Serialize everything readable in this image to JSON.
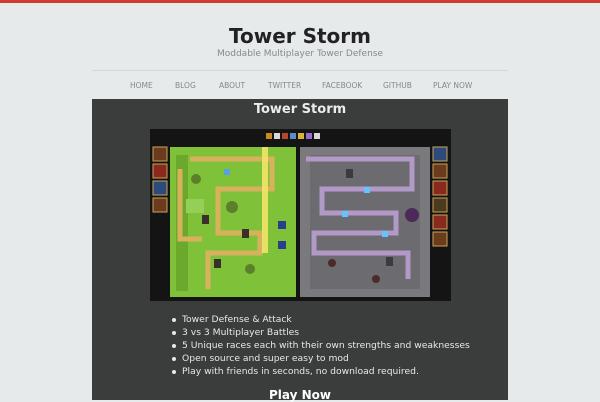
{
  "site": {
    "title": "Tower Storm",
    "tagline": "Moddable Multiplayer Tower Defense"
  },
  "nav": {
    "items": [
      {
        "label": "HOME"
      },
      {
        "label": "BLOG"
      },
      {
        "label": "ABOUT"
      },
      {
        "label": "TWITTER"
      },
      {
        "label": "FACEBOOK"
      },
      {
        "label": "GITHUB"
      },
      {
        "label": "PLAY NOW"
      }
    ]
  },
  "main": {
    "heading": "Tower Storm",
    "features": [
      "Tower Defense & Attack",
      "3 vs 3 Multiplayer Battles",
      "5 Unique races each with their own strengths and weaknesses",
      "Open source and super easy to mod",
      "Play with friends in seconds, no download required."
    ],
    "cta_label": "Play Now"
  },
  "colors": {
    "accent_bar": "#d23a2e",
    "panel_bg": "#3b3c3c",
    "grass": "#7fc23a",
    "stone": "#7a7a7e"
  }
}
